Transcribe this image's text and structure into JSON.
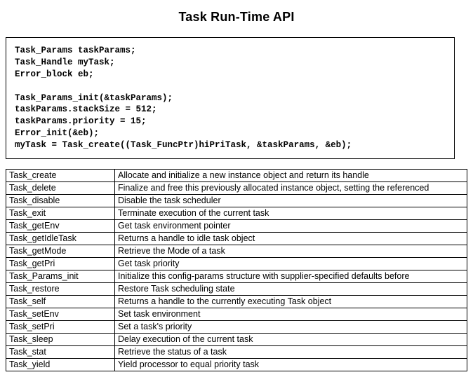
{
  "title": "Task Run-Time API",
  "code": "Task_Params taskParams;\nTask_Handle myTask;\nError_block eb;\n\nTask_Params_init(&taskParams);\ntaskParams.stackSize = 512;\ntaskParams.priority = 15;\nError_init(&eb);\nmyTask = Task_create((Task_FuncPtr)hiPriTask, &taskParams, &eb);",
  "api": [
    {
      "name": "Task_create",
      "desc": "Allocate and initialize a new instance object and return its handle"
    },
    {
      "name": "Task_delete",
      "desc": "Finalize and free this previously allocated instance object, setting the referenced"
    },
    {
      "name": "Task_disable",
      "desc": "Disable the task scheduler"
    },
    {
      "name": "Task_exit",
      "desc": "Terminate execution of the current task"
    },
    {
      "name": "Task_getEnv",
      "desc": "Get task environment pointer"
    },
    {
      "name": "Task_getIdleTask",
      "desc": "Returns a handle to idle task object"
    },
    {
      "name": "Task_getMode",
      "desc": "Retrieve the Mode of a task"
    },
    {
      "name": "Task_getPri",
      "desc": "Get task priority"
    },
    {
      "name": "Task_Params_init",
      "desc": "Initialize this config-params structure with supplier-specified defaults before"
    },
    {
      "name": "Task_restore",
      "desc": "Restore Task scheduling state"
    },
    {
      "name": "Task_self",
      "desc": "Returns a handle to the currently executing Task object"
    },
    {
      "name": "Task_setEnv",
      "desc": "Set task environment"
    },
    {
      "name": "Task_setPri",
      "desc": "Set a task's priority"
    },
    {
      "name": "Task_sleep",
      "desc": "Delay execution of the current task"
    },
    {
      "name": "Task_stat",
      "desc": "Retrieve the status of a task"
    },
    {
      "name": "Task_yield",
      "desc": "Yield processor to equal priority task"
    }
  ]
}
